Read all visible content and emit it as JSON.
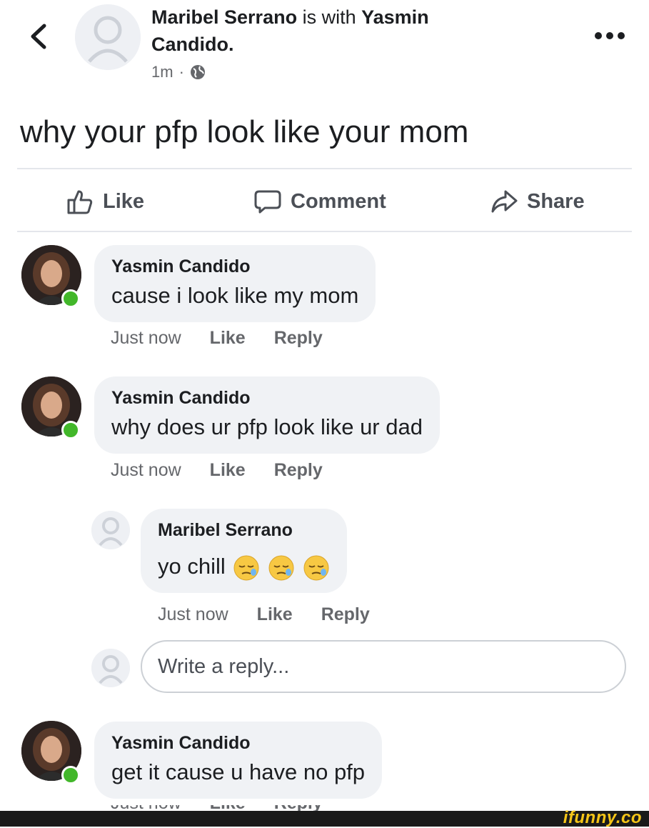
{
  "header": {
    "author": "Maribel Serrano",
    "with_word": "is with",
    "tagged_first": "Yasmin",
    "tagged_second": "Candido.",
    "time": "1m",
    "separator": "·",
    "privacy_icon": "globe-icon",
    "back_icon": "chevron-left-icon",
    "more_icon": "more-horizontal-icon"
  },
  "post": {
    "text": "why your pfp look like your mom"
  },
  "actions": {
    "like": "Like",
    "comment": "Comment",
    "share": "Share"
  },
  "comments": [
    {
      "author": "Yasmin Candido",
      "text": "cause i look like my mom",
      "time": "Just now",
      "like": "Like",
      "reply": "Reply"
    },
    {
      "author": "Yasmin Candido",
      "text": "why does ur pfp look like ur dad",
      "time": "Just now",
      "like": "Like",
      "reply": "Reply"
    },
    {
      "author": "Yasmin Candido",
      "text": "get it cause u have no pfp",
      "time": "Just now",
      "like": "Like",
      "reply": "Reply"
    }
  ],
  "reply": {
    "author": "Maribel Serrano",
    "text": "yo chill",
    "emoji": [
      "sleepy-face",
      "sleepy-face",
      "sleepy-face"
    ],
    "time": "Just now",
    "like": "Like",
    "reply": "Reply"
  },
  "reply_input": {
    "placeholder": "Write a reply..."
  },
  "watermark": "ifunny.co",
  "colors": {
    "presence": "#42b72a",
    "bubble": "#f0f2f5",
    "action_text": "#4b4f56",
    "meta_text": "#65676b"
  }
}
